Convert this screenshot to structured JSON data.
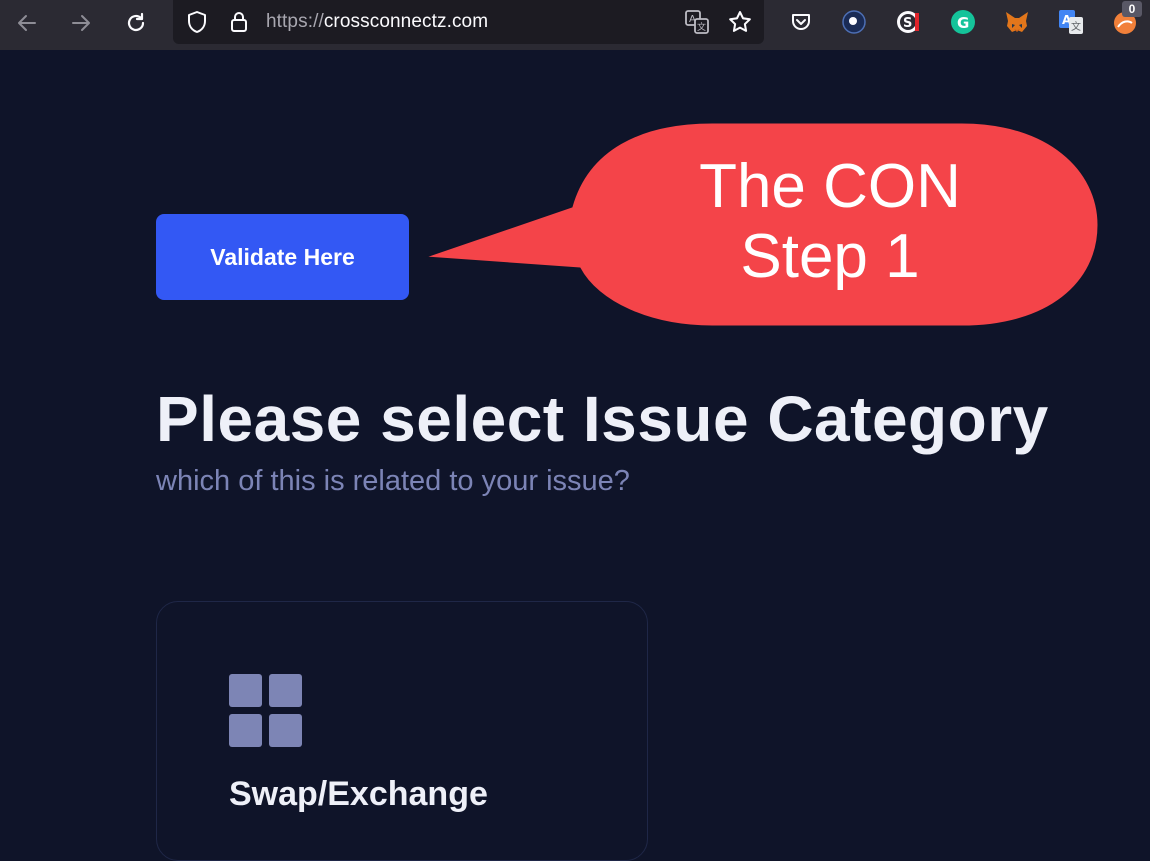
{
  "browser": {
    "url_protocol": "https://",
    "url_host": "crossconnectz.com",
    "extension_badge": "0",
    "icons": [
      "back-icon",
      "forward-icon",
      "reload-icon",
      "shield-icon",
      "lock-icon",
      "translate-icon",
      "star-icon",
      "pocket-icon",
      "extension-icons",
      "grammarly-icon",
      "metamask-fox-icon",
      "google-translate-icon"
    ]
  },
  "page": {
    "validate_label": "Validate Here",
    "title": "Please select Issue Category",
    "subtitle": "which of this is related to your issue?",
    "card": {
      "label": "Swap/Exchange",
      "icon": "grid-icon"
    }
  },
  "annotation": {
    "line1": "The CON",
    "line2": "Step 1",
    "color": "#f44449"
  },
  "colors": {
    "background": "#0f1429",
    "button": "#3358f4",
    "subtitle": "#7c84b6",
    "icon": "#7d85b5"
  }
}
